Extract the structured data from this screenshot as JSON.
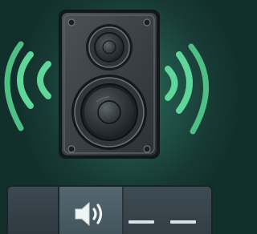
{
  "illustration": {
    "subject": "speaker-icon",
    "sound_waves": "sound-waves-icon"
  },
  "taskbar": {
    "volume_icon": "volume-icon",
    "indicator_count": 2
  },
  "colors": {
    "background": "#1f4f45",
    "wave": "#5fd69a",
    "speaker_body": "#3a4147",
    "bar": "#33414a",
    "dash": "#d8e3e4"
  }
}
